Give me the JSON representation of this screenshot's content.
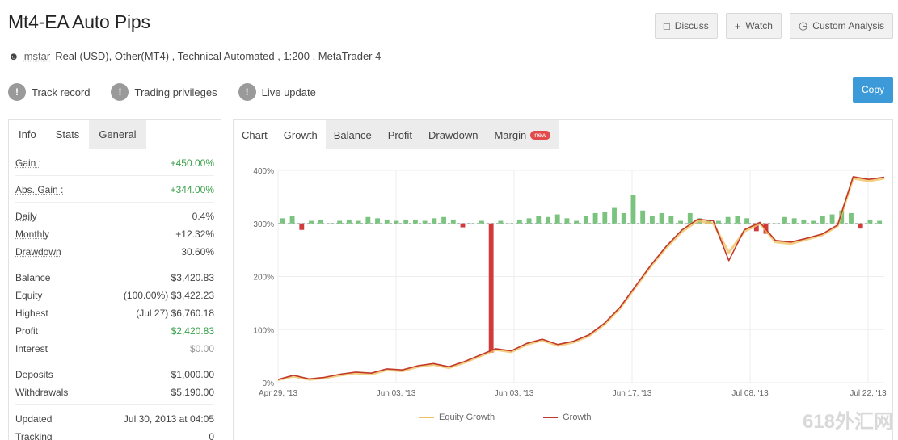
{
  "page": {
    "title": "Mt4-EA Auto Pips"
  },
  "header": {
    "buttons": [
      {
        "label": "Discuss",
        "icon": "chat-bubble-icon"
      },
      {
        "label": "Watch",
        "icon": "plus-icon"
      },
      {
        "label": "Custom Analysis",
        "icon": "clock-icon"
      }
    ]
  },
  "meta": {
    "owner": "mstar",
    "details": "Real (USD), Other(MT4) , Technical Automated , 1:200 , MetaTrader 4"
  },
  "badges": [
    {
      "label": "Track record"
    },
    {
      "label": "Trading privileges"
    },
    {
      "label": "Live update"
    }
  ],
  "copy_button": {
    "label": "Copy"
  },
  "left_tabs": [
    "Info",
    "Stats",
    "General"
  ],
  "stats": {
    "gain": {
      "label": "Gain :",
      "value": "+450.00%"
    },
    "abs_gain": {
      "label": "Abs. Gain :",
      "value": "+344.00%"
    },
    "daily": {
      "label": "Daily",
      "value": "0.4%"
    },
    "monthly": {
      "label": "Monthly",
      "value": "+12.32%"
    },
    "drawdown": {
      "label": "Drawdown",
      "value": "30.60%"
    },
    "balance": {
      "label": "Balance",
      "value": "$3,420.83"
    },
    "equity": {
      "label": "Equity",
      "value": "(100.00%) $3,422.23"
    },
    "highest": {
      "label": "Highest",
      "value": "(Jul 27) $6,760.18"
    },
    "profit": {
      "label": "Profit",
      "value": "$2,420.83"
    },
    "interest": {
      "label": "Interest",
      "value": "$0.00"
    },
    "deposits": {
      "label": "Deposits",
      "value": "$1,000.00"
    },
    "withdrawals": {
      "label": "Withdrawals",
      "value": "$5,190.00"
    },
    "updated": {
      "label": "Updated",
      "value": "Jul 30, 2013 at 04:05"
    },
    "tracking": {
      "label": "Tracking",
      "value": "0"
    }
  },
  "right_tabs": [
    {
      "label": "Chart",
      "new": false
    },
    {
      "label": "Growth",
      "new": false
    },
    {
      "label": "Balance",
      "new": false
    },
    {
      "label": "Profit",
      "new": false
    },
    {
      "label": "Drawdown",
      "new": false
    },
    {
      "label": "Margin",
      "new": true,
      "badge": "new"
    }
  ],
  "colors": {
    "growth_line": "#c0392b",
    "equity_line": "#f0c060",
    "bar_pos": "#7bc47f",
    "bar_neg": "#d23b3b",
    "accent": "#3d9ad8",
    "gain_green": "#3aa14a"
  },
  "chart_data": {
    "type": "line",
    "y_ticks": [
      "0%",
      "100%",
      "200%",
      "300%",
      "400%"
    ],
    "x_ticks": [
      "Apr 29, '13",
      "Jun 03, '13",
      "Jun 03, '13",
      "Jun 17, '13",
      "Jul 08, '13",
      "Jul 22, '13"
    ],
    "ylim": [
      0,
      400
    ],
    "series": [
      {
        "name": "Equity Growth",
        "values": [
          5,
          12,
          6,
          9,
          14,
          18,
          16,
          24,
          22,
          30,
          34,
          28,
          38,
          50,
          62,
          58,
          72,
          80,
          70,
          76,
          88,
          110,
          140,
          180,
          220,
          255,
          285,
          305,
          300,
          245,
          285,
          300,
          265,
          262,
          270,
          278,
          295,
          385,
          380,
          385
        ]
      },
      {
        "name": "Growth",
        "values": [
          6,
          14,
          7,
          10,
          16,
          20,
          18,
          26,
          24,
          32,
          36,
          30,
          40,
          52,
          64,
          60,
          74,
          82,
          72,
          78,
          90,
          112,
          142,
          182,
          222,
          258,
          288,
          308,
          305,
          230,
          288,
          302,
          268,
          265,
          272,
          280,
          297,
          388,
          383,
          387
        ]
      }
    ],
    "bars": [
      4,
      6,
      -5,
      2,
      3,
      0,
      2,
      3,
      2,
      5,
      4,
      3,
      2,
      3,
      3,
      2,
      4,
      5,
      3,
      -3,
      0,
      2,
      -100,
      2,
      0,
      3,
      4,
      6,
      5,
      7,
      4,
      2,
      6,
      8,
      9,
      12,
      8,
      22,
      10,
      6,
      8,
      6,
      2,
      8,
      4,
      3,
      2,
      5,
      6,
      4,
      -6,
      -8,
      0,
      5,
      4,
      3,
      2,
      6,
      7,
      10,
      8,
      -4,
      3,
      2
    ]
  },
  "watermark": "618外汇网"
}
